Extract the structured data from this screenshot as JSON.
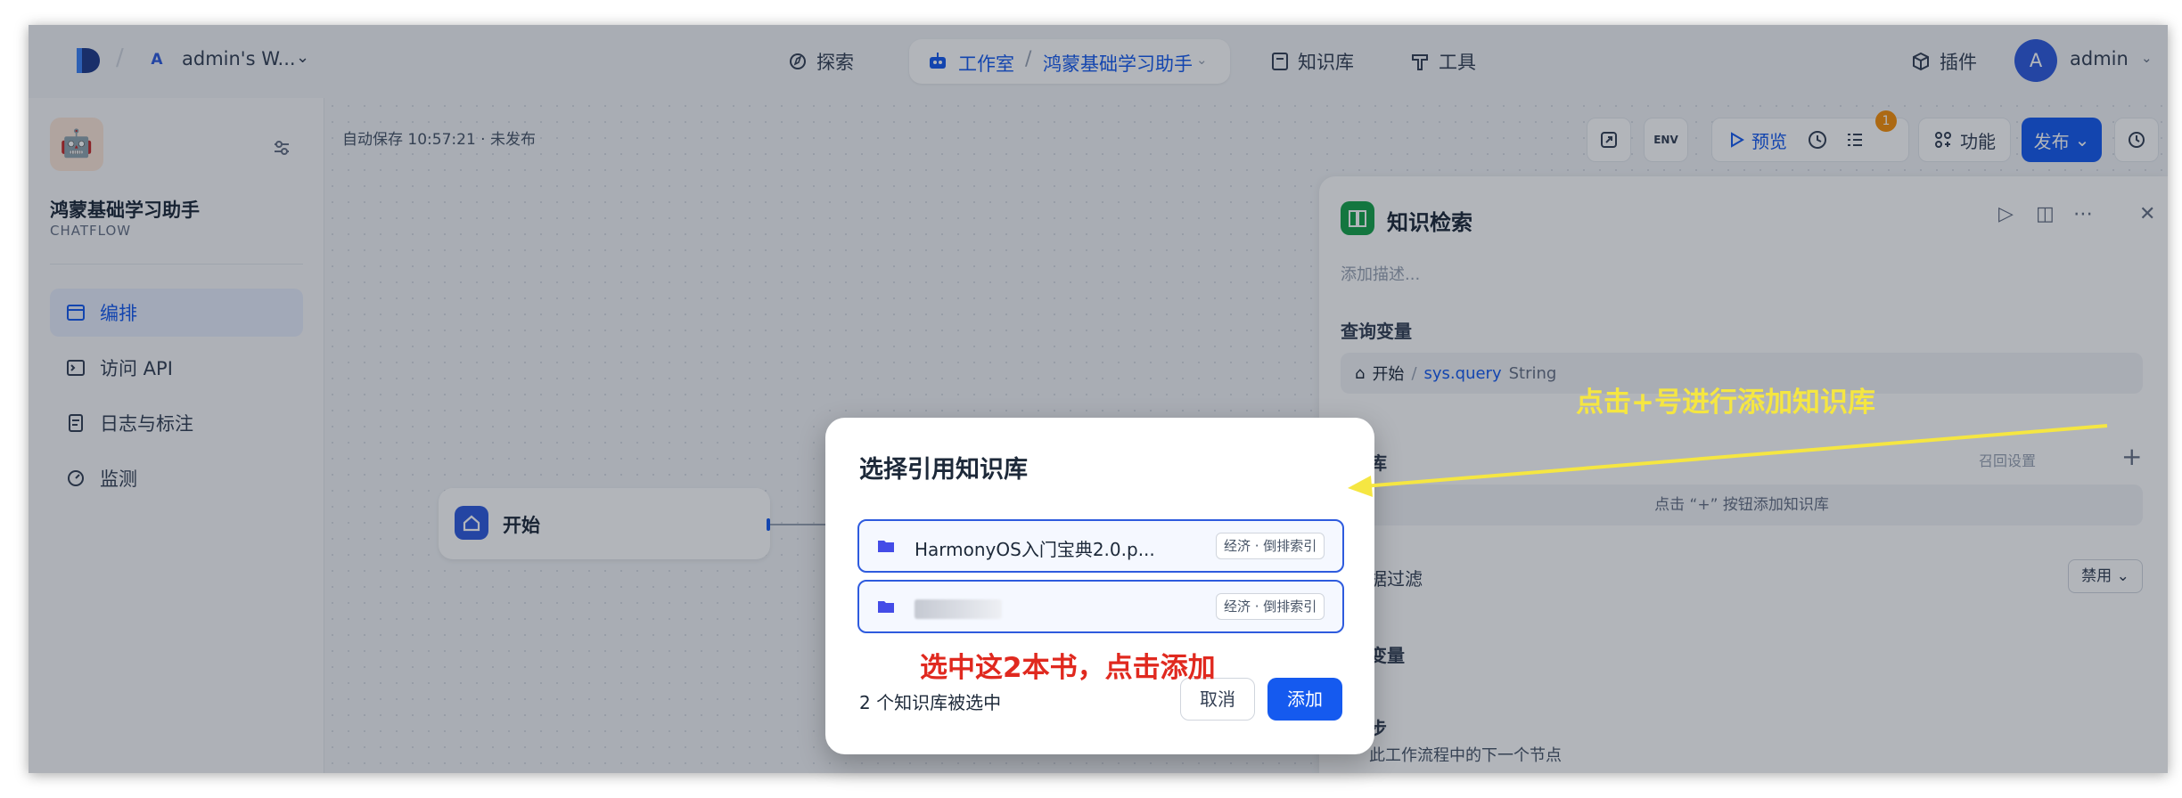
{
  "header": {
    "workspace_badge": "A",
    "workspace_name": "admin's W...",
    "nav": {
      "explore": "探索",
      "studio": "工作室",
      "app_name": "鸿蒙基础学习助手",
      "knowledge": "知识库",
      "tools": "工具",
      "plugins": "插件"
    },
    "user_initial": "A",
    "user_name": "admin"
  },
  "sidebar": {
    "app_name": "鸿蒙基础学习助手",
    "app_type": "CHATFLOW",
    "items": [
      {
        "label": "编排",
        "active": true
      },
      {
        "label": "访问 API"
      },
      {
        "label": "日志与标注"
      },
      {
        "label": "监测"
      }
    ]
  },
  "canvas": {
    "autosave": "自动保存 10:57:21 · 未发布",
    "toolbar": {
      "env": "ENV",
      "preview": "预览",
      "badge_count": "1",
      "features": "功能",
      "publish": "发布"
    },
    "start_node": "开始"
  },
  "panel": {
    "title": "知识检索",
    "description": "添加描述...",
    "query_label": "查询变量",
    "query_source": "开始",
    "query_sep": "/",
    "query_var": "sys.query",
    "query_type": "String",
    "kb_label": "库",
    "recall_label": "召回设置",
    "kb_empty": "点击 “+” 按钮添加知识库",
    "filter_label": "据过滤",
    "filter_value": "禁用",
    "output_label": "变量",
    "next_label": "步",
    "next_desc": "此工作流程中的下一个节点"
  },
  "modal": {
    "title": "选择引用知识库",
    "items": [
      {
        "name": "HarmonyOS入门宝典2.0.p...",
        "tag": "经济 · 倒排索引"
      },
      {
        "name": "",
        "tag": "经济 · 倒排索引"
      }
    ],
    "selected_count": "2 个知识库被选中",
    "cancel": "取消",
    "add": "添加"
  },
  "annotations": {
    "yellow": "点击+号进行添加知识库",
    "red": "选中这2本书，点击添加"
  },
  "colors": {
    "accent": "#155aef",
    "annotation_yellow": "#f5e642",
    "annotation_red": "#e0291f"
  }
}
